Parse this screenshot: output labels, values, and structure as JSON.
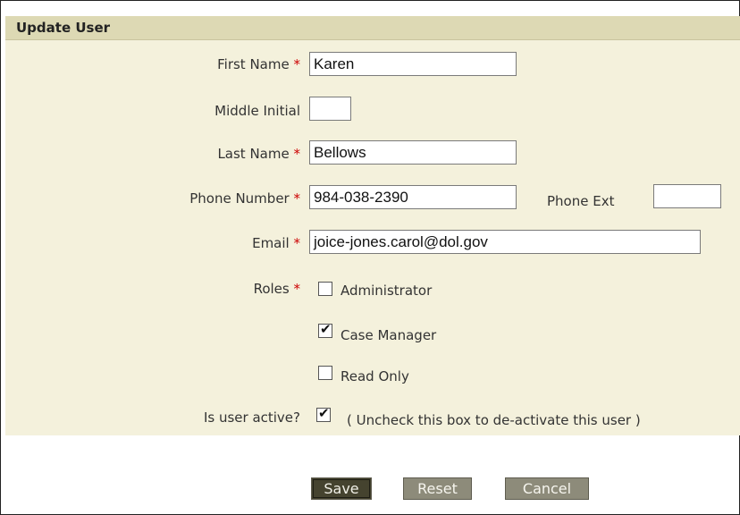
{
  "form": {
    "title": "Update User",
    "required_marker": "*",
    "first_name": {
      "label": "First Name",
      "value": "Karen"
    },
    "middle_initial": {
      "label": "Middle Initial",
      "value": ""
    },
    "last_name": {
      "label": "Last Name",
      "value": "Bellows"
    },
    "phone": {
      "label": "Phone Number",
      "value": "984-038-2390"
    },
    "phone_ext": {
      "label": "Phone Ext",
      "value": ""
    },
    "email": {
      "label": "Email",
      "value": "joice-jones.carol@dol.gov"
    },
    "roles": {
      "label": "Roles",
      "options": [
        {
          "label": "Administrator",
          "checked": false
        },
        {
          "label": "Case Manager",
          "checked": true
        },
        {
          "label": "Read Only",
          "checked": false
        }
      ]
    },
    "active": {
      "label": "Is user active?",
      "checked": true,
      "hint": "( Uncheck this box to de-activate this user )"
    }
  },
  "buttons": {
    "save": "Save",
    "reset": "Reset",
    "cancel": "Cancel"
  },
  "colors": {
    "panel": "#f4f1dc",
    "header": "#ddd9b4",
    "required": "#cc0000",
    "button": "#8d8b7a",
    "button_primary": "#45432f"
  }
}
